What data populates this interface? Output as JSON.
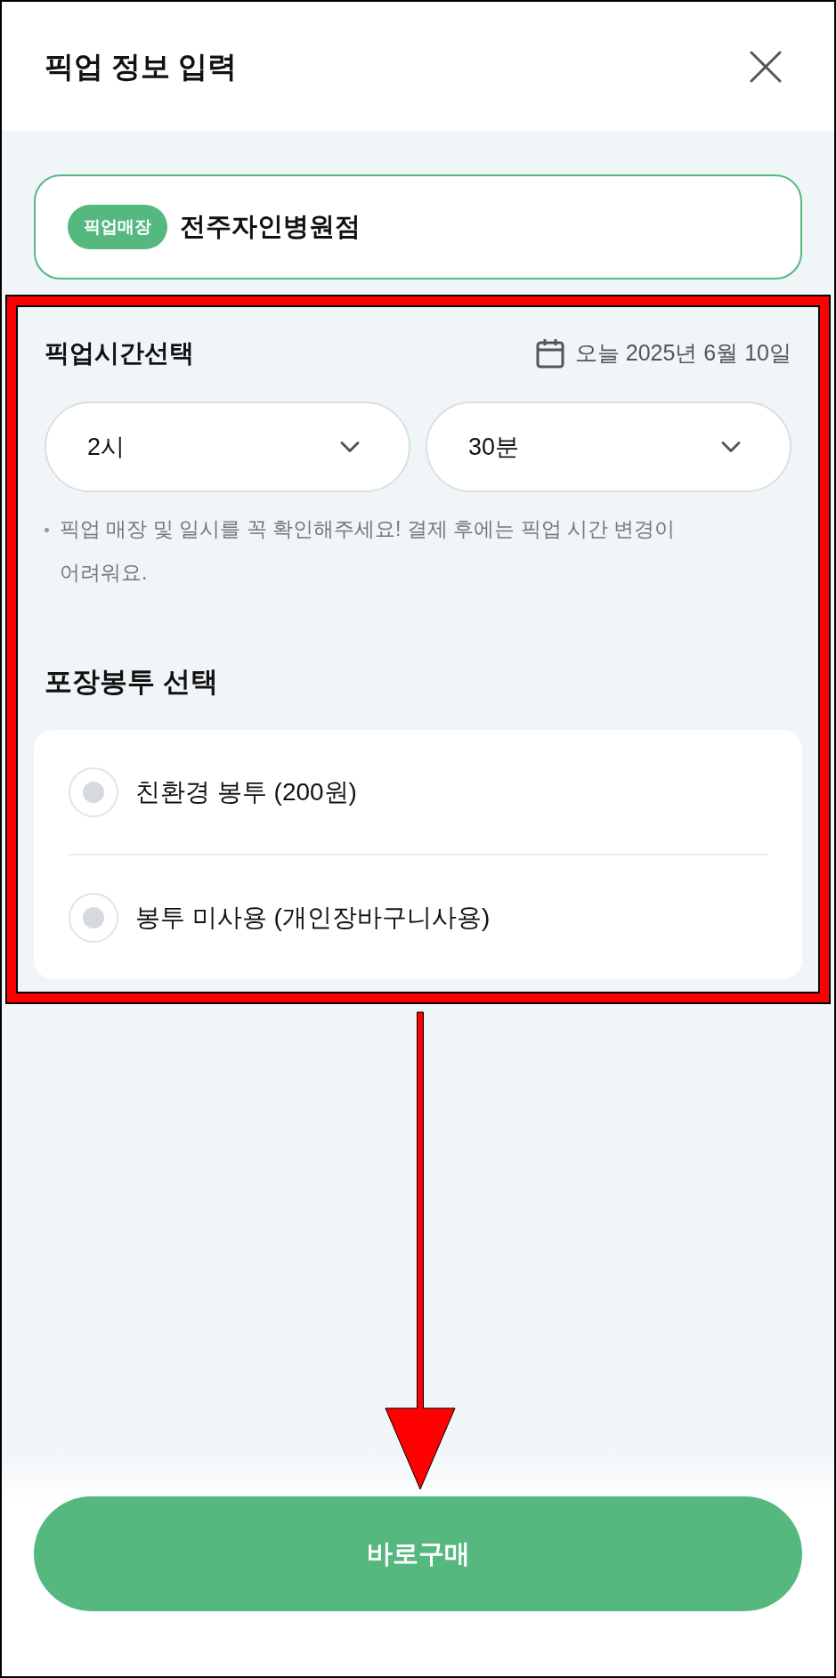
{
  "header": {
    "title": "픽업 정보 입력"
  },
  "store": {
    "badge": "픽업매장",
    "name": "전주자인병원점"
  },
  "pickup_time": {
    "title": "픽업시간선택",
    "date": "오늘 2025년 6월 10일",
    "selects": [
      {
        "value": "2시"
      },
      {
        "value": "30분"
      }
    ],
    "notice": "픽업 매장 및 일시를 꼭 확인해주세요! 결제 후에는 픽업 시간 변경이 어려워요."
  },
  "bag": {
    "title": "포장봉투 선택",
    "options": [
      {
        "label": "친환경 봉투 (200원)",
        "selected": false
      },
      {
        "label": "봉투 미사용 (개인장바구니사용)",
        "selected": false
      }
    ]
  },
  "buy_button": {
    "label": "바로구매"
  }
}
